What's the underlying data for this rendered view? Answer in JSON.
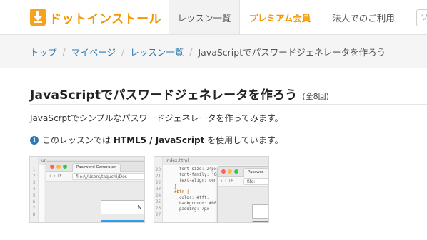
{
  "header": {
    "logo_text": "ドットインストール",
    "nav": {
      "lessons": "レッスン一覧",
      "premium": "プレミアム会員",
      "business": "法人でのご利用"
    },
    "search_placeholder": "ソ"
  },
  "breadcrumb": {
    "items": [
      "トップ",
      "マイページ",
      "レッスン一覧"
    ],
    "separator": "/",
    "current": "JavaScriptでパスワードジェネレータを作ろう"
  },
  "lesson": {
    "title": "JavaScriptでパスワードジェネレータを作ろう",
    "episode_count": "(全8回)",
    "description": "JavaScrptでシンプルなパスワードジェネレータを作ってみます。",
    "info_prefix": "このレッスンでは",
    "info_tech": "HTML5 / JavaScript",
    "info_suffix": "を使用しています。"
  },
  "thumbnails": [
    {
      "editor_tab": "un",
      "browser_tab": "Password Generator",
      "url": "file:///Users/taguchi/Des",
      "password_text": "W",
      "gutter_lines": "1\n2\n3\n4\n5\n6\n7\n8"
    },
    {
      "editor_tab": "index.html",
      "browser_tab": "Passwor",
      "url": "file:",
      "code_lines": {
        "l20": "      font-size: 24px;",
        "l21": "      font-family: 'Co",
        "l22": "      text-align: cent",
        "l23": "    }",
        "l24": "    #btn {",
        "l25": "      color: #fff;",
        "l26": "      background: #00",
        "l27": "      padding: 7px"
      },
      "gutter_lines": "20\n21\n22\n23\n24\n25\n26\n27"
    }
  ],
  "colors": {
    "brand_orange": "#f39800",
    "link_blue": "#2a7ab0",
    "button_blue": "#2f9de8"
  }
}
